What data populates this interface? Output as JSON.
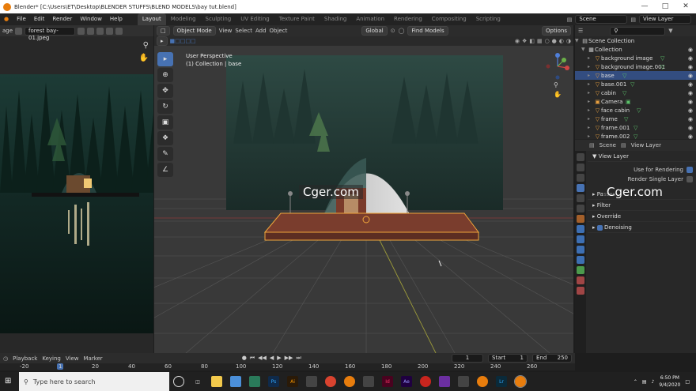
{
  "window": {
    "title": "Blender* [C:\\Users\\ET\\Desktop\\BLENDER STUFFS\\BLEND MODELS\\bay tut.blend]"
  },
  "menu": [
    "File",
    "Edit",
    "Render",
    "Window",
    "Help"
  ],
  "workspaces": [
    "Layout",
    "Modeling",
    "Sculpting",
    "UV Editing",
    "Texture Paint",
    "Shading",
    "Animation",
    "Rendering",
    "Compositing",
    "Scripting"
  ],
  "scene": {
    "scene_name": "Scene",
    "view_layer": "View Layer"
  },
  "image_editor": {
    "mode": "age",
    "image_name": "forest bay-01.jpeg"
  },
  "viewport": {
    "mode": "Object Mode",
    "menus": [
      "View",
      "Select",
      "Add",
      "Object"
    ],
    "orientation": "Global",
    "find": "Find Models",
    "options": "Options",
    "info_line1": "User Perspective",
    "info_line2": "(1) Collection | base"
  },
  "outliner": {
    "root": "Scene Collection",
    "items": [
      {
        "name": "Collection",
        "sel": false
      },
      {
        "name": "background image",
        "sel": false
      },
      {
        "name": "background image.001",
        "sel": false
      },
      {
        "name": "base",
        "sel": true
      },
      {
        "name": "base.001",
        "sel": false
      },
      {
        "name": "cabin",
        "sel": false
      },
      {
        "name": "Camera",
        "sel": false
      },
      {
        "name": "face cabin",
        "sel": false
      },
      {
        "name": "frame",
        "sel": false
      },
      {
        "name": "frame.001",
        "sel": false
      },
      {
        "name": "frame.002",
        "sel": false
      }
    ]
  },
  "properties": {
    "tab_scene": "Scene",
    "tab_view_layer": "View Layer",
    "section": "View Layer",
    "use_for_rendering": "Use for Rendering",
    "render_single_layer": "Render Single Layer",
    "passes": "Passes",
    "filter": "Filter",
    "override": "Override",
    "denoising": "Denoising"
  },
  "timeline": {
    "menus": [
      "Playback",
      "Keying",
      "View",
      "Marker"
    ],
    "current_frame": "1",
    "start_label": "Start",
    "start": "1",
    "end_label": "End",
    "end": "250",
    "ruler": [
      "-20",
      "1",
      "20",
      "40",
      "60",
      "80",
      "100",
      "120",
      "140",
      "160",
      "180",
      "200",
      "220",
      "240",
      "260"
    ]
  },
  "taskbar": {
    "search_placeholder": "Type here to search",
    "time": "6:50 PM",
    "date": "9/4/2020"
  },
  "watermark": "Cger.com"
}
